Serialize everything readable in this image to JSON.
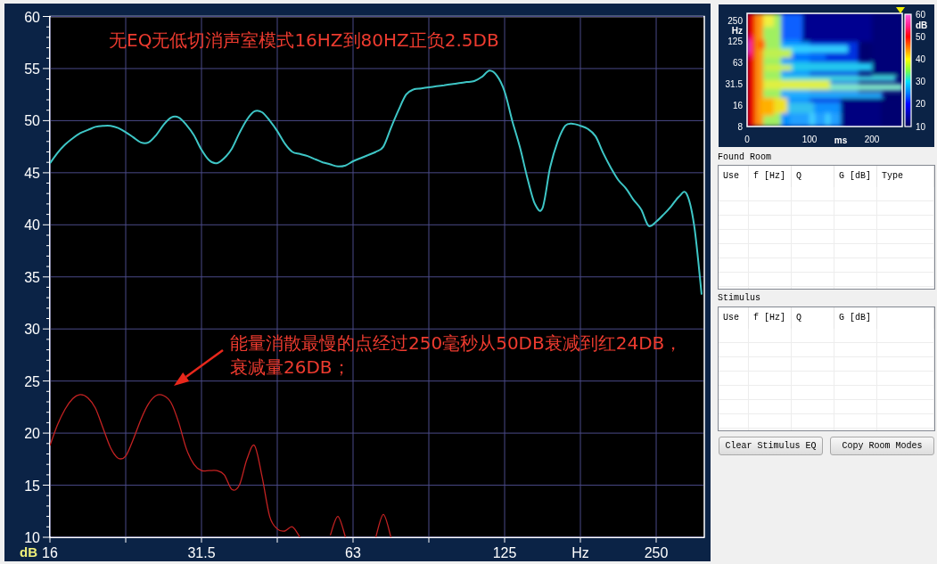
{
  "chart": {
    "chart_data": {
      "type": "line",
      "xlabel": "Hz",
      "ylabel": "dB",
      "grid": true,
      "categories": [
        "16",
        null,
        null,
        null,
        null,
        null,
        null,
        null,
        null,
        null,
        null,
        null,
        null,
        null,
        null,
        null,
        null,
        null,
        null,
        null,
        "31.5",
        null,
        null,
        null,
        null,
        null,
        null,
        null,
        null,
        null,
        null,
        null,
        null,
        null,
        null,
        null,
        null,
        null,
        null,
        null,
        "63",
        null,
        null,
        null,
        null,
        null,
        null,
        null,
        null,
        null,
        null,
        null,
        null,
        null,
        null,
        null,
        null,
        null,
        null,
        null,
        "125",
        null,
        null,
        null,
        null,
        null,
        null,
        null,
        null,
        null,
        null,
        null,
        null,
        null,
        null,
        null,
        null,
        null,
        null,
        null,
        "250",
        null,
        null,
        null,
        null,
        null,
        null
      ],
      "series": [
        {
          "color": "#3ec6c6",
          "values": [
            45.9,
            46.9,
            47.7,
            48.3,
            48.8,
            49.1,
            49.4,
            49.5,
            49.5,
            49.3,
            48.9,
            48.4,
            47.9,
            47.9,
            48.6,
            49.6,
            50.3,
            50.3,
            49.6,
            48.6,
            47.2,
            46.2,
            45.9,
            46.4,
            47.3,
            48.8,
            50.1,
            50.9,
            50.8,
            50.0,
            49.0,
            47.8,
            47.0,
            46.8,
            46.6,
            46.3,
            46.0,
            45.8,
            45.6,
            45.7,
            46.1,
            46.4,
            46.7,
            47.0,
            47.5,
            49.3,
            51.0,
            52.5,
            53.0,
            53.1,
            53.2,
            53.3,
            53.4,
            53.5,
            53.6,
            53.7,
            53.8,
            54.2,
            54.8,
            54.3,
            52.8,
            50.0,
            47.5,
            44.5,
            42.0,
            41.6,
            45.5,
            48.0,
            49.5,
            49.7,
            49.5,
            49.2,
            48.5,
            46.9,
            45.5,
            44.3,
            43.5,
            42.4,
            41.5,
            39.9,
            40.3,
            41.0,
            41.8,
            42.7,
            43.0,
            40.0,
            33.3
          ]
        },
        {
          "color": "#c42222",
          "values": [
            18.8,
            20.8,
            22.3,
            23.3,
            23.7,
            23.4,
            22.4,
            20.5,
            18.6,
            17.6,
            17.8,
            19.4,
            21.3,
            22.8,
            23.6,
            23.6,
            22.9,
            21.0,
            18.5,
            17.0,
            16.4,
            16.4,
            16.4,
            16.0,
            14.6,
            15.0,
            17.5,
            18.8,
            15.8,
            12.0,
            10.8,
            10.6,
            11.0,
            10.0,
            null,
            null,
            null,
            10.2,
            12.0,
            10.0,
            null,
            null,
            null,
            10.0,
            12.2,
            10.0,
            null,
            null,
            null,
            null,
            null,
            null,
            null,
            null,
            null,
            null,
            null,
            null,
            null,
            null,
            null,
            null,
            null,
            null,
            null,
            null,
            null,
            null,
            null,
            null,
            null,
            null,
            null,
            null,
            null,
            null,
            null,
            null,
            null,
            null,
            null,
            null,
            null,
            null,
            null,
            null,
            null
          ]
        }
      ],
      "ylim": [
        10,
        60
      ],
      "yticks": [
        10,
        15,
        20,
        25,
        30,
        35,
        40,
        45,
        50,
        55,
        60
      ],
      "annotations": [
        "无EQ无低切消声室模式16HZ到80HZ正负2.5DB",
        "能量消散最慢的点经过250毫秒从50DB衰减到红24DB，衰减量26DB；"
      ]
    }
  },
  "spectrogram": {
    "y_ticks": [
      "250",
      "125",
      "63",
      "31.5",
      "16",
      "8"
    ],
    "y_unit": "Hz",
    "x_ticks": [
      "0",
      "100",
      "200"
    ],
    "x_unit": "ms",
    "scale_ticks": [
      "60",
      "50",
      "40",
      "30",
      "20",
      "10"
    ],
    "scale_unit": "dB"
  },
  "found_room": {
    "title": "Found Room",
    "columns": [
      "Use",
      "f [Hz]",
      "Q",
      "G [dB]",
      "Type"
    ]
  },
  "stimulus": {
    "title": "Stimulus",
    "columns": [
      "Use",
      "f [Hz]",
      "Q",
      "G [dB]"
    ]
  },
  "buttons": [
    "Clear Stimulus EQ",
    "Copy Room Modes"
  ]
}
